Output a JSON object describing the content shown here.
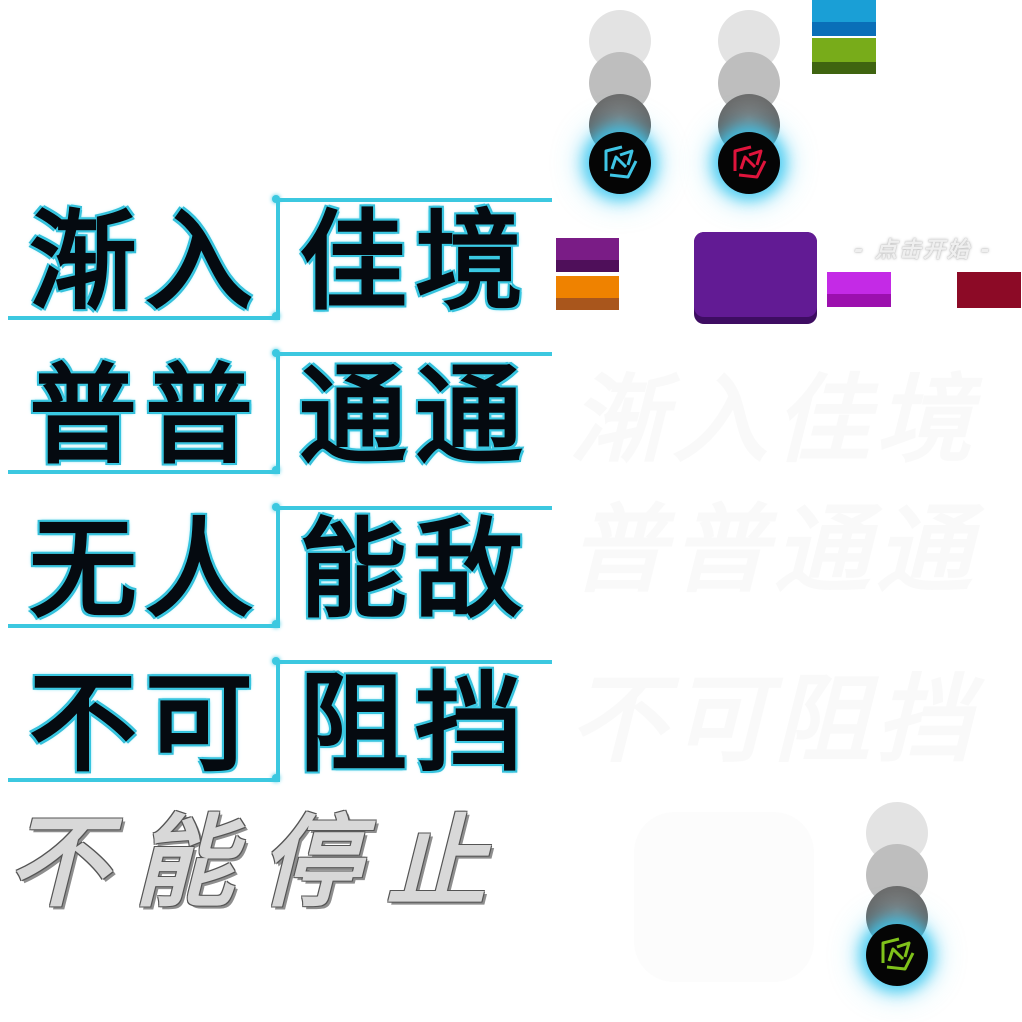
{
  "title_rows": [
    {
      "left": "渐入",
      "right": "佳境"
    },
    {
      "left": "普普",
      "right": "通通"
    },
    {
      "left": "无人",
      "right": "能敌"
    },
    {
      "left": "不可",
      "right": "阻挡"
    }
  ],
  "chrome_text": "不能停止",
  "ghost_texts": [
    "渐入佳境",
    "普普通通",
    "不可阻挡"
  ],
  "start_label": "- 点击开始 -",
  "orbs": [
    {
      "icon": "cyan-arrow-icon",
      "color": "#3fc6e6"
    },
    {
      "icon": "red-arrow-icon",
      "color": "#e0143c"
    },
    {
      "icon": "green-arrow-icon",
      "color": "#7fc21a"
    }
  ],
  "colors": {
    "neon": "#3cc8e0",
    "blue_top": "#1a9fd6",
    "blue_bottom": "#0a6fb8",
    "green_top": "#78ac1a",
    "green_bottom": "#3f6410",
    "purple_top": "#7a1c86",
    "purple_bottom": "#4f0f5a",
    "orange_top": "#ef8200",
    "orange_bottom": "#a9561c",
    "violet_panel": "#621b94",
    "violet_panel_shadow": "#3e0d62",
    "magenta_top": "#c42ae6",
    "magenta_bottom": "#9c10ae",
    "crimson": "#8c0a26"
  }
}
